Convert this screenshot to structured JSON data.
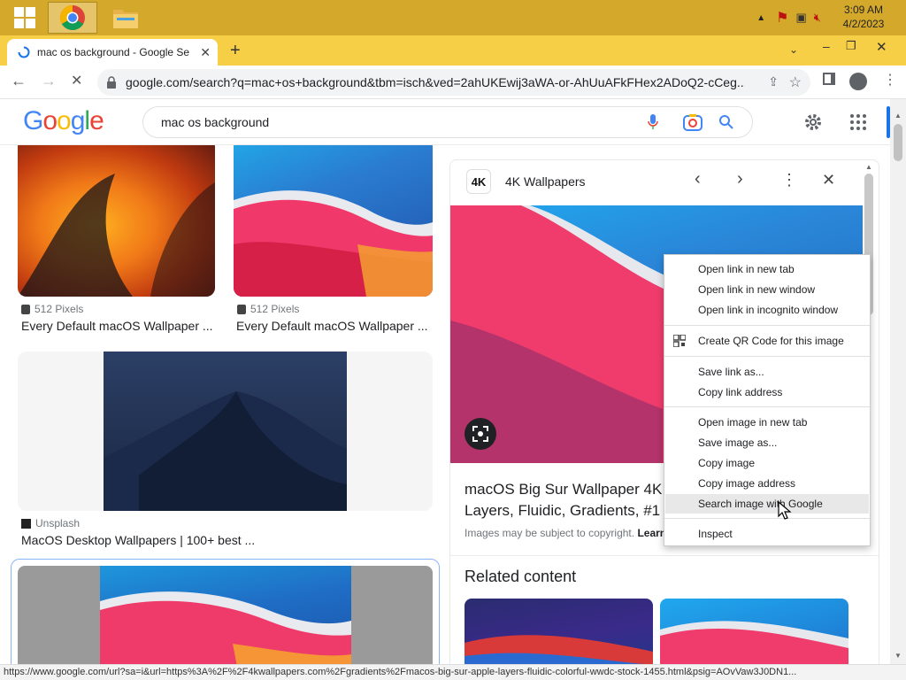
{
  "taskbar": {
    "clock_time": "3:09 AM",
    "clock_date": "4/2/2023"
  },
  "browser": {
    "tab_title": "mac os background - Google Se",
    "url": "google.com/search?q=mac+os+background&tbm=isch&ved=2ahUKEwij3aWA-or-AhUuAFkFHex2ADoQ2-cCeg..."
  },
  "google": {
    "logo": "Google",
    "search_query": "mac os background"
  },
  "results": [
    {
      "source": "512 Pixels",
      "title": "Every Default macOS Wallpaper ..."
    },
    {
      "source": "512 Pixels",
      "title": "Every Default macOS Wallpaper ..."
    },
    {
      "source": "Unsplash",
      "title": "MacOS Desktop Wallpapers | 100+ best ..."
    }
  ],
  "panel": {
    "site_icon_text": "4K",
    "site_name": "4K Wallpapers",
    "title_line1": "macOS Big Sur Wallpaper 4K",
    "title_line2": "Layers, Fluidic, Gradients, #1",
    "copyright": "Images may be subject to copyright.",
    "learn_more": "Learn",
    "related_heading": "Related content"
  },
  "context_menu": {
    "items": [
      "Open link in new tab",
      "Open link in new window",
      "Open link in incognito window",
      "Create QR Code for this image",
      "Save link as...",
      "Copy link address",
      "Open image in new tab",
      "Save image as...",
      "Copy image",
      "Copy image address",
      "Search image with Google",
      "Inspect"
    ]
  },
  "status_url": "https://www.google.com/url?sa=i&url=https%3A%2F%2F4kwallpapers.com%2Fgradients%2Fmacos-big-sur-apple-layers-fluidic-colorful-wwdc-stock-1455.html&psig=AOvVaw3J0DN1...",
  "colors": {
    "taskbar": "#d4a82a",
    "tabbar": "#f6cf46",
    "google_blue": "#4285f4",
    "google_red": "#ea4335",
    "google_yellow": "#fbbc05",
    "google_green": "#34a853",
    "menu_highlight": "#e8e8e8"
  }
}
